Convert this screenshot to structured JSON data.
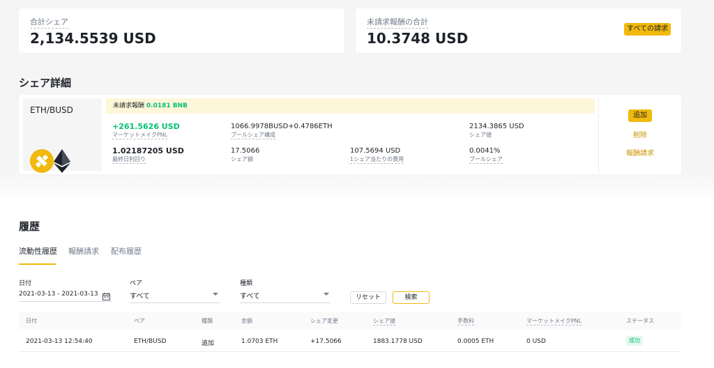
{
  "summary": {
    "total_share_label": "合計シェア",
    "total_share_value": "2,134.5539 USD",
    "unclaimed_label": "未請求報酬の合計",
    "unclaimed_value": "10.3748 USD",
    "claim_all_label": "すべての請求"
  },
  "share_detail": {
    "title": "シェア詳細",
    "pair": "ETH/BUSD",
    "reward_label": "未請求報酬",
    "reward_value": "0.0181 BNB",
    "stats": {
      "pnl_value": "+261.5626 USD",
      "pnl_label": "マーケットメイクPNL",
      "pool_comp_value": "1066.9978BUSD+0.4786ETH",
      "pool_comp_label": "プールシェア構成",
      "share_value_value": "2134.3865 USD",
      "share_value_label": "シェア値",
      "yield_value": "1.02187205 USD",
      "yield_label": "最終日利回り",
      "share_amount_value": "17.5066",
      "share_amount_label": "シェア額",
      "cost_per_share_value": "107.5694 USD",
      "cost_per_share_label": "1シェア当たりの費用",
      "pool_share_value": "0.0041%",
      "pool_share_label": "プールシェア"
    },
    "actions": {
      "add": "追加",
      "remove": "削除",
      "claim": "報酬請求"
    }
  },
  "history": {
    "title": "履歴",
    "tabs": [
      "流動性履歴",
      "報酬請求",
      "配布履歴"
    ],
    "filters": {
      "date_label": "日付",
      "date_value": "2021-03-13 - 2021-03-13",
      "pair_label": "ペア",
      "pair_value": "すべて",
      "type_label": "種類",
      "type_value": "すべて",
      "reset": "リセット",
      "search": "検索"
    },
    "columns": [
      "日付",
      "ペア",
      "種類",
      "金額",
      "シェア変更",
      "シェア値",
      "手数料",
      "マーケットメイクPNL",
      "ステータス"
    ],
    "rows": [
      {
        "date": "2021-03-13 12:54:40",
        "pair": "ETH/BUSD",
        "type": "追加",
        "amount": "1.0703 ETH",
        "share_change": "+17.5066",
        "share_value": "1883.1778 USD",
        "fee": "0.0005 ETH",
        "pnl": "0 USD",
        "status": "成功"
      }
    ]
  },
  "colors": {
    "accent": "#f0b90b",
    "positive": "#02c076",
    "link": "#c99400"
  },
  "icons": [
    "busd-icon",
    "eth-icon",
    "calendar-icon",
    "chevron-down-icon"
  ]
}
